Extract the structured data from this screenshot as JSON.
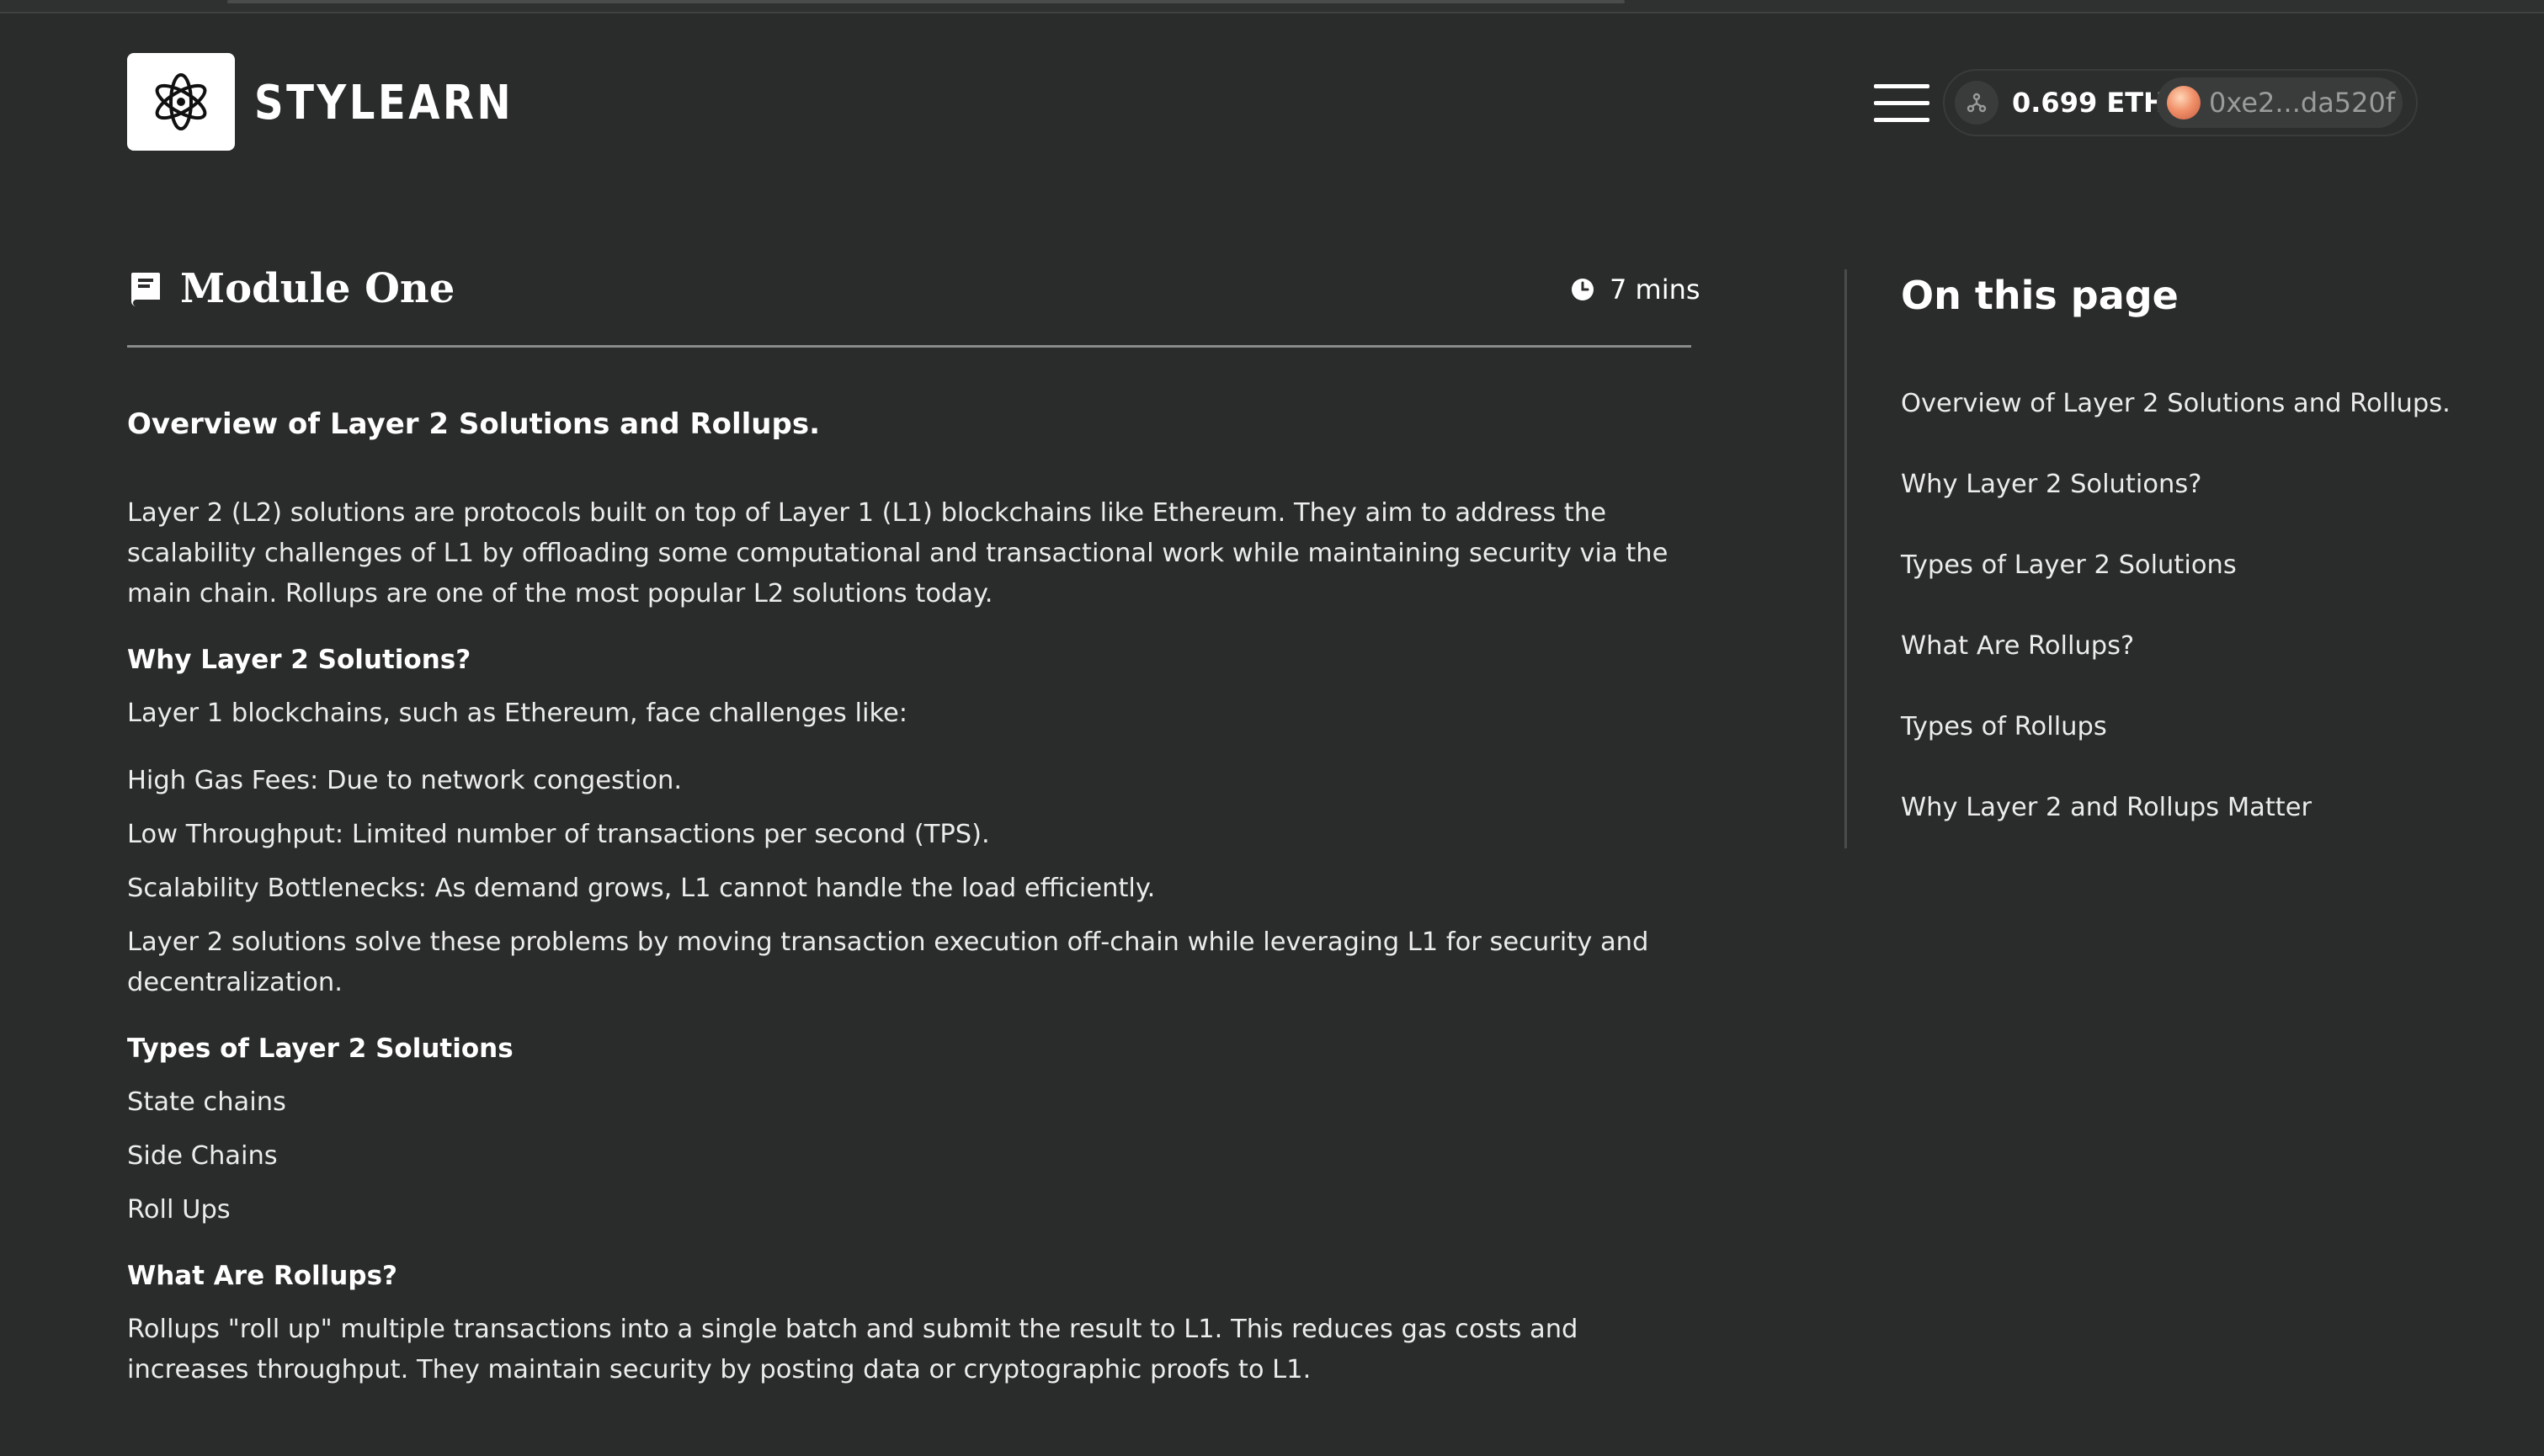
{
  "header": {
    "brand": "STYLEARN",
    "eth_balance": "0.699 ETH",
    "wallet_address": "0xe2...da520f"
  },
  "module": {
    "title": "Module One",
    "duration": "7 mins"
  },
  "content": {
    "title": "Overview of Layer 2 Solutions and Rollups.",
    "intro": "Layer 2 (L2) solutions are protocols built on top of Layer 1 (L1) blockchains like Ethereum. They aim to address the scalability challenges of L1 by offloading some computational and transactional work while maintaining security via the main chain. Rollups are one of the most popular L2 solutions today.",
    "why_heading": "Why Layer 2 Solutions?",
    "why_text": "Layer 1 blockchains, such as Ethereum, face challenges like:",
    "challenges": [
      "High Gas Fees: Due to network congestion.",
      "Low Throughput: Limited number of transactions per second (TPS).",
      "Scalability Bottlenecks: As demand grows, L1 cannot handle the load efficiently."
    ],
    "solution_text": "Layer 2 solutions solve these problems by moving transaction execution off-chain while leveraging L1 for security and decentralization.",
    "types_heading": "Types of Layer 2 Solutions",
    "types": [
      "State chains",
      "Side Chains",
      "Roll Ups"
    ],
    "rollups_heading": "What Are Rollups?",
    "rollups_text": "Rollups \"roll up\" multiple transactions into a single batch and submit the result to L1. This reduces gas costs and increases throughput. They maintain security by posting data or cryptographic proofs to L1."
  },
  "toc": {
    "title": "On this page",
    "items": [
      "Overview of Layer 2 Solutions and Rollups.",
      "Why Layer 2 Solutions?",
      "Types of Layer 2 Solutions",
      "What Are Rollups?",
      "Types of Rollups",
      "Why Layer 2 and Rollups Matter"
    ]
  },
  "icons": {
    "logo": "flower-knot-logo-icon",
    "menu": "hamburger-menu-icon",
    "eth": "network-nodes-icon",
    "module": "book-icon",
    "duration": "clock-icon"
  },
  "colors": {
    "background": "#2a2b2b",
    "text": "#ececec",
    "accent_white": "#ffffff"
  }
}
